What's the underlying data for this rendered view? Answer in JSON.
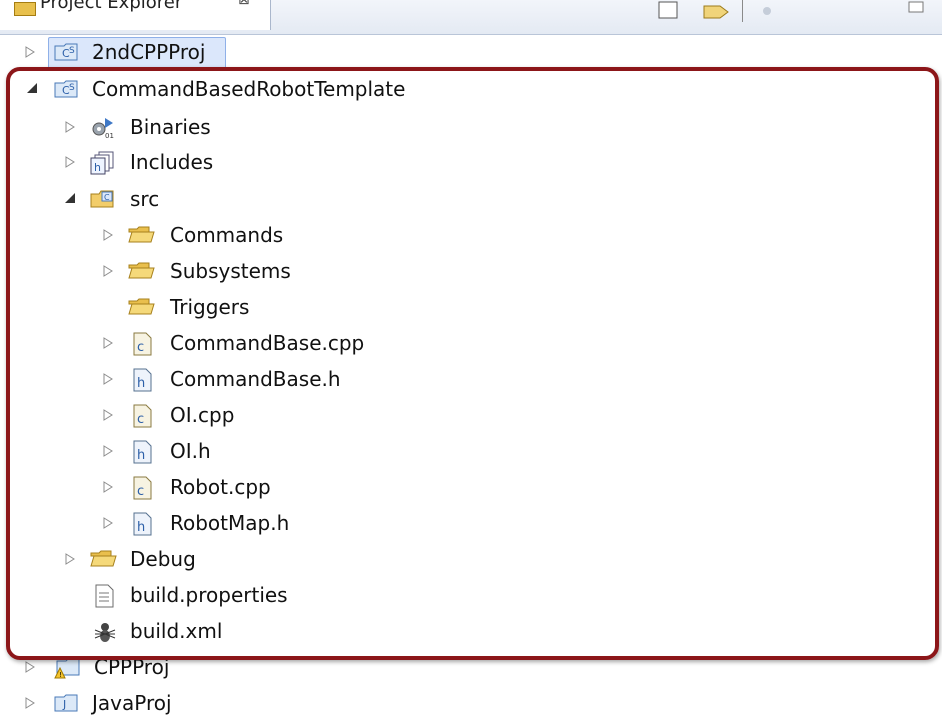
{
  "view": {
    "title": "Project Explorer",
    "close_glyph": "⊠"
  },
  "projects": [
    {
      "label": "2ndCPPProj",
      "icon": "cpp-project-icon",
      "state": "collapsed",
      "selected": true
    },
    {
      "label": "CommandBasedRobotTemplate",
      "icon": "cpp-project-icon",
      "state": "expanded"
    },
    {
      "label": "CPPProj",
      "icon": "cpp-project-warning-icon",
      "state": "collapsed"
    },
    {
      "label": "JavaProj",
      "icon": "java-project-icon",
      "state": "collapsed"
    }
  ],
  "robot_template_children": [
    {
      "label": "Binaries",
      "icon": "binaries-icon",
      "state": "collapsed"
    },
    {
      "label": "Includes",
      "icon": "includes-icon",
      "state": "collapsed"
    },
    {
      "label": "src",
      "icon": "source-folder-icon",
      "state": "expanded"
    },
    {
      "label": "Debug",
      "icon": "folder-icon",
      "state": "collapsed"
    },
    {
      "label": "build.properties",
      "icon": "text-file-icon",
      "state": "leaf"
    },
    {
      "label": "build.xml",
      "icon": "ant-build-icon",
      "state": "leaf"
    }
  ],
  "src_children": [
    {
      "label": "Commands",
      "icon": "folder-icon",
      "state": "collapsed"
    },
    {
      "label": "Subsystems",
      "icon": "folder-icon",
      "state": "collapsed"
    },
    {
      "label": "Triggers",
      "icon": "folder-icon",
      "state": "leaf"
    },
    {
      "label": "CommandBase.cpp",
      "icon": "c-source-file-icon",
      "state": "collapsed"
    },
    {
      "label": "CommandBase.h",
      "icon": "header-file-icon",
      "state": "collapsed"
    },
    {
      "label": "OI.cpp",
      "icon": "c-source-file-icon",
      "state": "collapsed"
    },
    {
      "label": "OI.h",
      "icon": "header-file-icon",
      "state": "collapsed"
    },
    {
      "label": "Robot.cpp",
      "icon": "c-source-file-icon",
      "state": "collapsed"
    },
    {
      "label": "RobotMap.h",
      "icon": "header-file-icon",
      "state": "collapsed"
    }
  ],
  "colors": {
    "highlight_border": "#8c1619",
    "selection_bg": "#dbe7fb",
    "folder_fill": "#f2cd6a"
  }
}
